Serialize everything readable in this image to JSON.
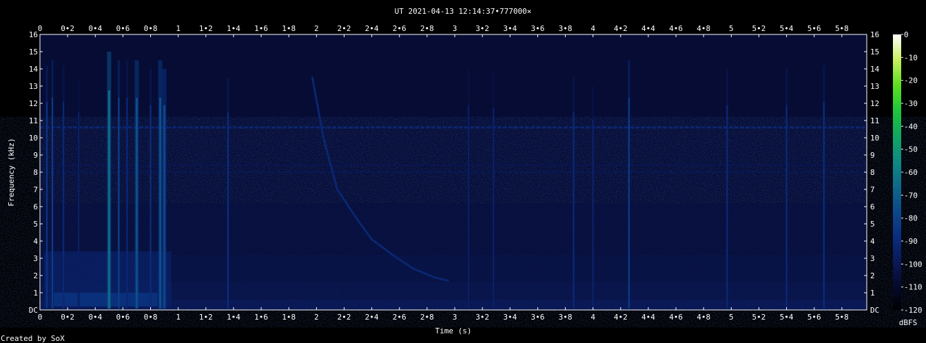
{
  "chart_data": {
    "type": "heatmap",
    "title": "UT 2021-04-13 12:14:37•777000×",
    "xlabel": "Time (s)",
    "ylabel": "Frequency (kHz)",
    "xlim": [
      0,
      5.98
    ],
    "ylim": [
      0,
      16
    ],
    "x_ticks": [
      "0",
      "0•2",
      "0•4",
      "0•6",
      "0•8",
      "1",
      "1•2",
      "1•4",
      "1•6",
      "1•8",
      "2",
      "2•2",
      "2•4",
      "2•6",
      "2•8",
      "3",
      "3•2",
      "3•4",
      "3•6",
      "3•8",
      "4",
      "4•2",
      "4•4",
      "4•6",
      "4•8",
      "5",
      "5•2",
      "5•4",
      "5•6",
      "5•8"
    ],
    "y_ticks": [
      "DC",
      "1",
      "2",
      "3",
      "4",
      "5",
      "6",
      "7",
      "8",
      "9",
      "10",
      "11",
      "12",
      "13",
      "14",
      "15",
      "16"
    ],
    "colorbar": {
      "label": "dBFS",
      "ticks": [
        "0",
        "-10",
        "-20",
        "-30",
        "-40",
        "-50",
        "-60",
        "-70",
        "-80",
        "-90",
        "-100",
        "-110",
        "-120"
      ],
      "range": [
        -120,
        0
      ],
      "colors": [
        "#000000",
        "#050a30",
        "#0a1a5a",
        "#0a2f80",
        "#0d4a8a",
        "#0e6a8a",
        "#0f8c80",
        "#10a860",
        "#1fc83a",
        "#60e020",
        "#c8f060",
        "#ffffff"
      ]
    },
    "background_level_dbfs": -108,
    "tones": [
      {
        "freq_khz": 10.6,
        "level_dbfs": -92
      },
      {
        "freq_khz": 8.4,
        "level_dbfs": -101
      },
      {
        "freq_khz": 8.0,
        "level_dbfs": -100
      }
    ],
    "impulses": [
      {
        "t": 0.05,
        "fmax": 14.2,
        "level_dbfs": -85
      },
      {
        "t": 0.09,
        "fmax": 14.5,
        "level_dbfs": -82
      },
      {
        "t": 0.17,
        "fmax": 14.2,
        "level_dbfs": -90
      },
      {
        "t": 0.28,
        "fmax": 13.5,
        "level_dbfs": -95
      },
      {
        "t": 0.5,
        "fmax": 15.0,
        "level_dbfs": -65
      },
      {
        "t": 0.57,
        "fmax": 14.5,
        "level_dbfs": -80
      },
      {
        "t": 0.63,
        "fmax": 14.5,
        "level_dbfs": -90
      },
      {
        "t": 0.7,
        "fmax": 14.5,
        "level_dbfs": -75
      },
      {
        "t": 0.8,
        "fmax": 14.0,
        "level_dbfs": -88
      },
      {
        "t": 0.87,
        "fmax": 14.5,
        "level_dbfs": -75
      },
      {
        "t": 0.9,
        "fmax": 14.0,
        "level_dbfs": -78
      },
      {
        "t": 1.36,
        "fmax": 13.5,
        "level_dbfs": -88
      },
      {
        "t": 3.1,
        "fmax": 14.0,
        "level_dbfs": -95
      },
      {
        "t": 3.28,
        "fmax": 13.8,
        "level_dbfs": -94
      },
      {
        "t": 3.86,
        "fmax": 13.5,
        "level_dbfs": -90
      },
      {
        "t": 4.0,
        "fmax": 13.0,
        "level_dbfs": -93
      },
      {
        "t": 4.26,
        "fmax": 14.5,
        "level_dbfs": -82
      },
      {
        "t": 4.97,
        "fmax": 14.0,
        "level_dbfs": -90
      },
      {
        "t": 5.4,
        "fmax": 14.0,
        "level_dbfs": -90
      },
      {
        "t": 5.67,
        "fmax": 14.2,
        "level_dbfs": -88
      }
    ],
    "whistler": [
      {
        "t": 1.97,
        "f": 13.5
      },
      {
        "t": 2.05,
        "f": 10.0
      },
      {
        "t": 2.15,
        "f": 7.0
      },
      {
        "t": 2.3,
        "f": 5.2
      },
      {
        "t": 2.4,
        "f": 4.1
      },
      {
        "t": 2.55,
        "f": 3.2
      },
      {
        "t": 2.7,
        "f": 2.4
      },
      {
        "t": 2.85,
        "f": 1.9
      },
      {
        "t": 2.95,
        "f": 1.7
      }
    ]
  },
  "footer": {
    "credit": "Created by SoX"
  }
}
